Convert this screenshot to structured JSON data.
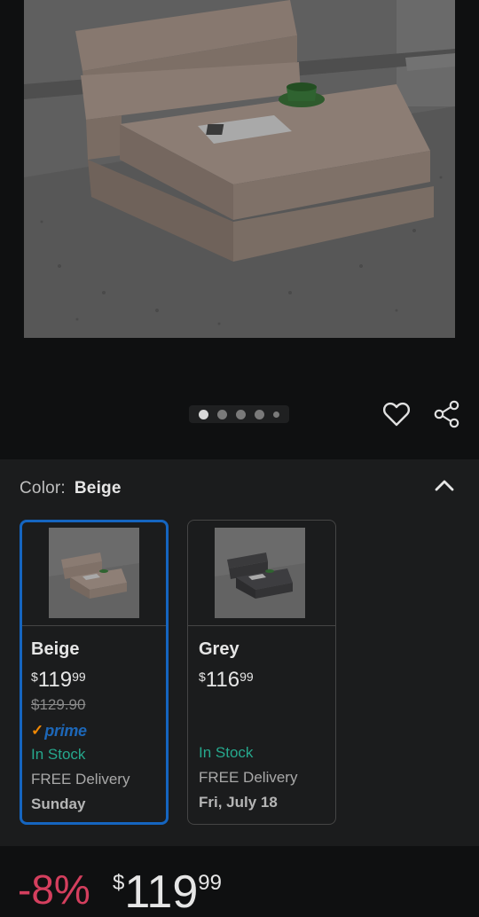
{
  "hero": {
    "carousel": {
      "total_images": 5,
      "active_index": 0
    }
  },
  "actions": {
    "wishlist_icon": "heart-outline-icon",
    "share_icon": "share-icon"
  },
  "color_selector": {
    "label": "Color:",
    "selected_value": "Beige",
    "collapse_icon": "chevron-up-icon",
    "options": [
      {
        "name": "Beige",
        "price_currency": "$",
        "price_whole": "119",
        "price_fraction": "99",
        "list_price": "$129.90",
        "prime_check": "✓",
        "prime_label": "prime",
        "stock": "In Stock",
        "delivery": "FREE Delivery",
        "delivery_day": "Sunday",
        "selected": true
      },
      {
        "name": "Grey",
        "price_currency": "$",
        "price_whole": "116",
        "price_fraction": "99",
        "stock": "In Stock",
        "delivery": "FREE Delivery",
        "delivery_day": "Fri, July 18",
        "selected": false
      }
    ]
  },
  "price_bar": {
    "discount": "-8%",
    "currency": "$",
    "whole": "119",
    "fraction": "99"
  },
  "colors": {
    "selected_border": "#1565c0",
    "stock_green": "#26a88d",
    "discount_red": "#d43f5e",
    "prime_blue": "#1d67b8",
    "prime_orange": "#f08804"
  }
}
